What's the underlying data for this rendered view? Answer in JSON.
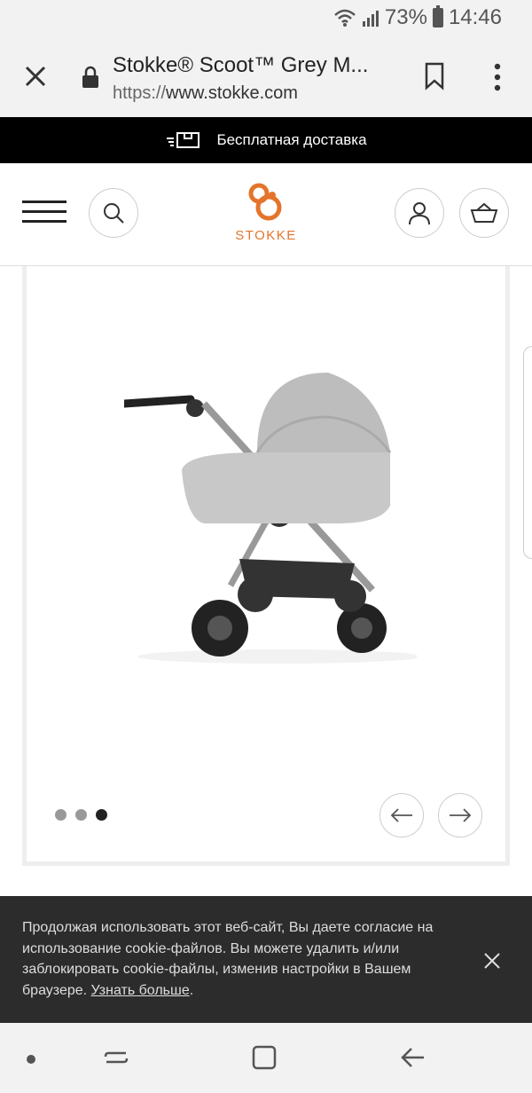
{
  "status": {
    "battery": "73%",
    "time": "14:46"
  },
  "browser": {
    "title": "Stokke® Scoot™ Grey M...",
    "url_scheme": "https://",
    "url_host": "www.stokke.com"
  },
  "promo": {
    "text": "Бесплатная доставка"
  },
  "header": {
    "logo_text": "STOKKE"
  },
  "gallery": {
    "slides": 3,
    "active_index": 2
  },
  "cookie": {
    "text": "Продолжая использовать этот веб-сайт, Вы даете согласие на использование cookie-файлов. Вы можете удалить и/или заблокировать cookie-файлы, изменив настройки в Вашем браузере.",
    "link": "Узнать больше",
    "tail": "."
  },
  "colors": {
    "brand": "#e4742b",
    "promo_bg": "#000000",
    "cookie_bg": "#2c2c2c"
  }
}
